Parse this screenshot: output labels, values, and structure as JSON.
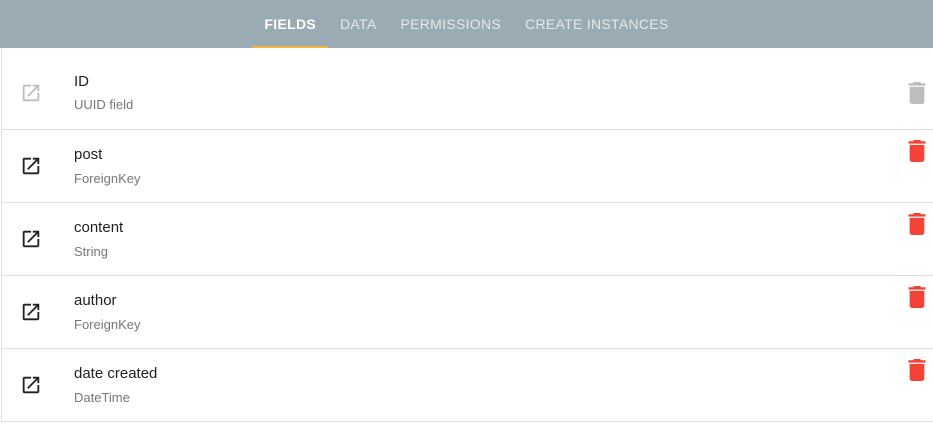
{
  "tabs": [
    {
      "label": "FIELDS",
      "active": true
    },
    {
      "label": "DATA",
      "active": false
    },
    {
      "label": "PERMISSIONS",
      "active": false
    },
    {
      "label": "CREATE INSTANCES",
      "active": false
    }
  ],
  "colors": {
    "header_bg": "#9aabb3",
    "tab_indicator": "#f4b53f",
    "delete_active": "#f44336",
    "delete_disabled": "#bdbdbd",
    "icon_active": "#212121",
    "icon_disabled": "#bdbdbd"
  },
  "fields": [
    {
      "name": "ID",
      "type": "UUID field",
      "disabled": true,
      "open_icon": "open-in-new-icon",
      "delete_icon": "trash-icon"
    },
    {
      "name": "post",
      "type": "ForeignKey",
      "disabled": false,
      "open_icon": "open-in-new-icon",
      "delete_icon": "trash-icon"
    },
    {
      "name": "content",
      "type": "String",
      "disabled": false,
      "open_icon": "open-in-new-icon",
      "delete_icon": "trash-icon"
    },
    {
      "name": "author",
      "type": "ForeignKey",
      "disabled": false,
      "open_icon": "open-in-new-icon",
      "delete_icon": "trash-icon"
    },
    {
      "name": "date created",
      "type": "DateTime",
      "disabled": false,
      "open_icon": "open-in-new-icon",
      "delete_icon": "trash-icon"
    }
  ]
}
